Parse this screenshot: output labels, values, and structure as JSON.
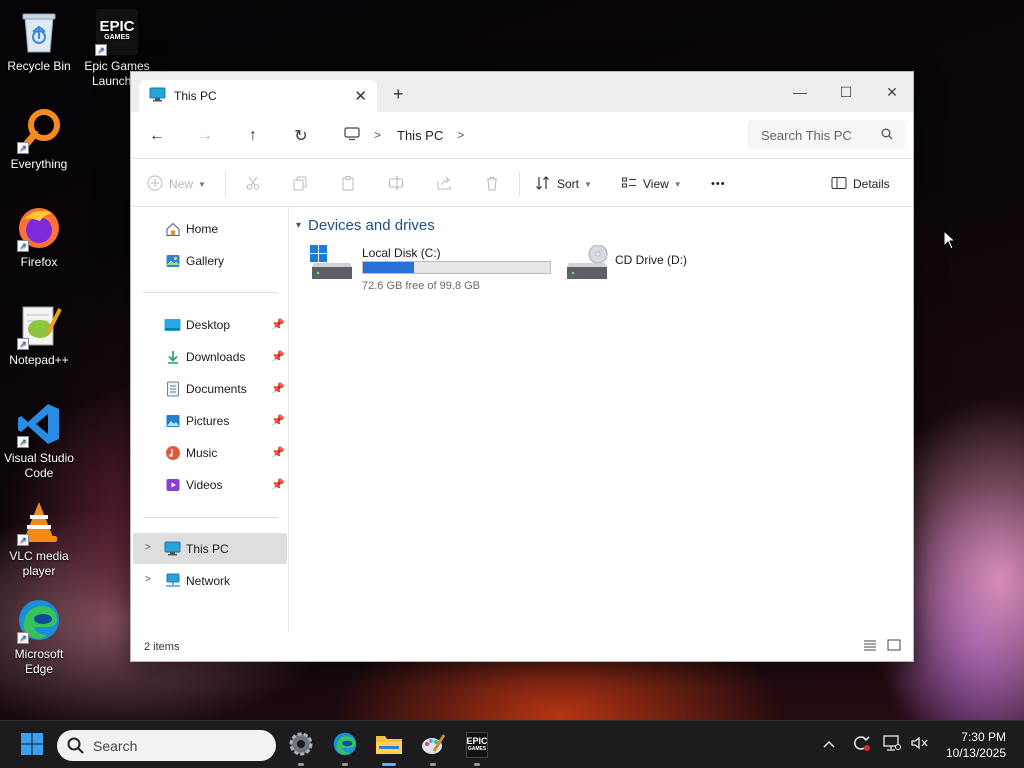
{
  "desktop": {
    "icons": [
      {
        "label": "Recycle Bin",
        "icon": "recycle-bin-icon"
      },
      {
        "label": "Epic Games Launcher",
        "icon": "epic-games-icon"
      },
      {
        "label": "Everything",
        "icon": "everything-search-icon"
      },
      {
        "label": "Firefox",
        "icon": "firefox-icon"
      },
      {
        "label": "Notepad++",
        "icon": "notepad-plus-plus-icon"
      },
      {
        "label": "Visual Studio Code",
        "icon": "vscode-icon"
      },
      {
        "label": "VLC media player",
        "icon": "vlc-icon"
      },
      {
        "label": "Microsoft Edge",
        "icon": "edge-icon"
      }
    ],
    "epic_logo_text": "EPIC GAMES"
  },
  "explorer": {
    "tab": {
      "title": "This PC",
      "icon": "monitor-icon"
    },
    "new_tab_glyph": "+",
    "window_controls": {
      "minimize": "—",
      "maximize": "☐",
      "close": "✕"
    },
    "nav": {
      "back": "←",
      "forward": "→",
      "up": "↑",
      "refresh": "↻",
      "breadcrumb": [
        "This PC"
      ],
      "search_placeholder": "Search This PC"
    },
    "commands": {
      "new_label": "New",
      "sort_label": "Sort",
      "view_label": "View",
      "more_label": "•••",
      "details_label": "Details"
    },
    "sidebar": {
      "items": [
        {
          "label": "Home",
          "icon": "home-icon"
        },
        {
          "label": "Gallery",
          "icon": "gallery-icon"
        },
        {
          "label": "Desktop",
          "icon": "desktop-folder-icon",
          "pinned": true
        },
        {
          "label": "Downloads",
          "icon": "download-icon",
          "pinned": true
        },
        {
          "label": "Documents",
          "icon": "documents-icon",
          "pinned": true
        },
        {
          "label": "Pictures",
          "icon": "pictures-icon",
          "pinned": true
        },
        {
          "label": "Music",
          "icon": "music-icon",
          "pinned": true
        },
        {
          "label": "Videos",
          "icon": "videos-icon",
          "pinned": true
        },
        {
          "label": "This PC",
          "icon": "monitor-icon",
          "selected": true
        },
        {
          "label": "Network",
          "icon": "network-icon"
        }
      ]
    },
    "content": {
      "group_title": "Devices and drives",
      "drives": [
        {
          "name": "Local Disk (C:)",
          "free_text": "72.6 GB free of 99.8 GB",
          "used_fraction": 0.273
        },
        {
          "name": "CD Drive (D:)"
        }
      ]
    },
    "status": {
      "item_count": "2 items"
    }
  },
  "taskbar": {
    "search_placeholder": "Search",
    "apps": [
      "start-icon",
      "settings-icon",
      "edge-icon",
      "file-explorer-icon",
      "paint-icon",
      "epic-games-icon"
    ],
    "clock_time": "7:30 PM",
    "clock_date": "10/13/2025"
  },
  "colors": {
    "accent": "#2670d6",
    "group_header": "#1f4e8c",
    "taskbar": "#1c1c1e"
  }
}
